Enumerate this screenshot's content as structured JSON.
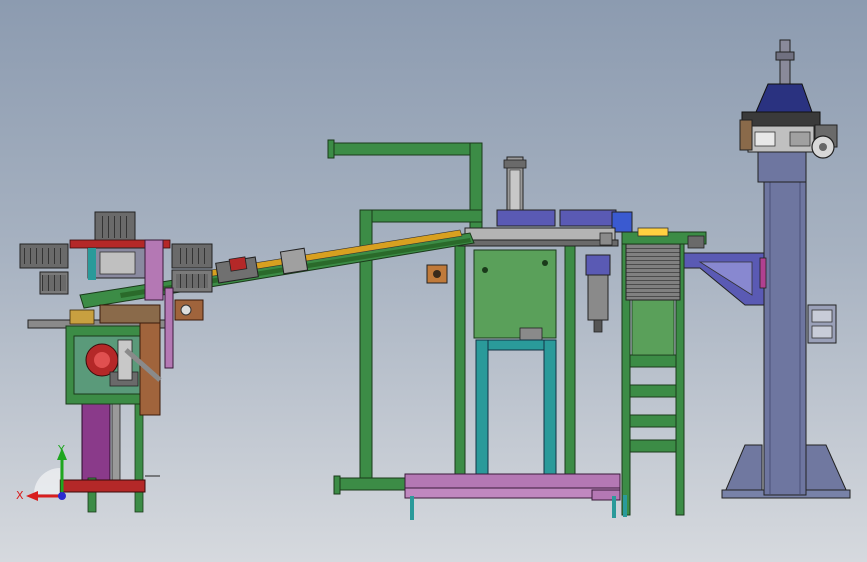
{
  "view": {
    "background_top": "#8c9bb0",
    "background_bottom": "#d6d9de"
  },
  "triad": {
    "x_label": "X",
    "y_label": "Y",
    "x_color": "#d81e1e",
    "y_color": "#1fa61f",
    "z_color": "#2a2ad0"
  },
  "colors": {
    "frame_green": "#3c8c46",
    "plate_green": "#5aa05a",
    "base_purple": "#b478b4",
    "column_slate": "#7078a0",
    "bracket_blue": "#5a5ab4",
    "accent_red": "#b42828",
    "accent_brown": "#a0643c",
    "cyan_leg": "#2a9a9a"
  },
  "components": [
    "left-feeder-station",
    "inclined-conveyor",
    "press-station",
    "stacker-tower",
    "vertical-column"
  ]
}
